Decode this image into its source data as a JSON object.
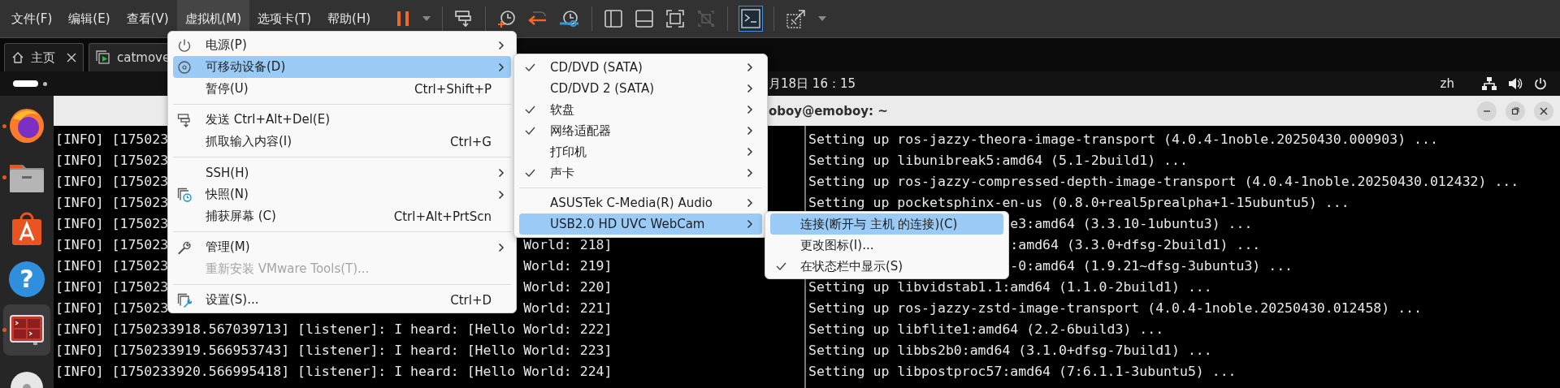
{
  "menubar": [
    {
      "label": "文件(F)",
      "selected": false
    },
    {
      "label": "编辑(E)",
      "selected": false
    },
    {
      "label": "查看(V)",
      "selected": false
    },
    {
      "label": "虚拟机(M)",
      "selected": true
    },
    {
      "label": "选项卡(T)",
      "selected": false
    },
    {
      "label": "帮助(H)",
      "selected": false
    }
  ],
  "toolbar": [
    {
      "kind": "pause",
      "selected": false
    },
    {
      "kind": "caret",
      "selected": false
    },
    {
      "kind": "separator"
    },
    {
      "kind": "send-keys",
      "selected": false
    },
    {
      "kind": "separator"
    },
    {
      "kind": "snapshot-take",
      "selected": false
    },
    {
      "kind": "snapshot-revert",
      "selected": false
    },
    {
      "kind": "snapshot-manager",
      "selected": false
    },
    {
      "kind": "separator"
    },
    {
      "kind": "sidebar",
      "selected": false
    },
    {
      "kind": "thumbnails",
      "selected": false
    },
    {
      "kind": "fullscreen",
      "selected": false
    },
    {
      "kind": "unity",
      "selected": false
    },
    {
      "kind": "separator"
    },
    {
      "kind": "console",
      "selected": true
    },
    {
      "kind": "separator"
    },
    {
      "kind": "stretch",
      "selected": false
    },
    {
      "kind": "caret",
      "selected": false
    }
  ],
  "tabs": [
    {
      "label": "主页",
      "kind": "home",
      "selected": false
    },
    {
      "label": "catmove",
      "kind": "vm",
      "selected": true
    }
  ],
  "top_bar": {
    "clock": "月18日  16：15",
    "language": "zh"
  },
  "dock": [
    {
      "kind": "firefox",
      "running": true,
      "selected": false
    },
    {
      "kind": "files",
      "running": true,
      "selected": false
    },
    {
      "kind": "app-store",
      "running": false,
      "selected": false
    },
    {
      "kind": "help",
      "glyph": "?",
      "running": false,
      "selected": false
    },
    {
      "kind": "terminal",
      "running": true,
      "selected": true
    },
    {
      "kind": "disc",
      "running": false,
      "selected": false
    }
  ],
  "terminal": {
    "title": "oboy@emoboy: ~",
    "left_pane": [
      {
        "head": "[INFO] [175023"
      },
      {
        "head": "[INFO] [175023"
      },
      {
        "head": "[INFO] [175023"
      },
      {
        "head": "[INFO] [175023"
      },
      {
        "head": "[INFO] [175023"
      },
      {
        "head": "[INFO] [175023",
        "tail": "World: 218]"
      },
      {
        "head": "[INFO] [175023",
        "tail": "World: 219]"
      },
      {
        "head": "[INFO] [175023",
        "tail": "World: 220]"
      },
      {
        "head": "[INFO] [175023",
        "tail": "World: 221]"
      },
      {
        "head": "[INFO] [1750233918.567039713] [listener]: I heard: [Hello World: 222]"
      },
      {
        "head": "[INFO] [1750233919.566953743] [listener]: I heard: [Hello World: 223]"
      },
      {
        "head": "[INFO] [1750233920.566995418] [listener]: I heard: [Hello World: 224]"
      }
    ],
    "right_pane": [
      {
        "head": "Setting up ros-jazzy-theora-image-transport (4.0.4-1noble.20250430.000903) ..."
      },
      {
        "head": "Setting up libunibreak5:amd64 (5.1-2build1) ..."
      },
      {
        "head": "Setting up ros-jazzy-compressed-depth-image-transport (4.0.4-1noble.20250430.012432) ..."
      },
      {
        "head": "Setting up pocketsphinx-en-us (0.8.0+real5prealpha+1-15ubuntu5) ..."
      },
      {
        "tail": "e3:amd64 (3.3.10-1ubuntu3) ..."
      },
      {
        "tail": ":amd64 (3.3.0+dfsg-2build1) ..."
      },
      {
        "tail": "-0:amd64 (1.9.21~dfsg-3ubuntu3) ..."
      },
      {
        "head": "Setting up libvidstab1.1:amd64 (1.1.0-2build1) ..."
      },
      {
        "head": "Setting up ros-jazzy-zstd-image-transport (4.0.4-1noble.20250430.012458) ..."
      },
      {
        "head": "Setting up libflite1:amd64 (2.2-6build3) ..."
      },
      {
        "head": "Setting up libbs2b0:amd64 (3.1.0+dfsg-7build1) ..."
      },
      {
        "head": "Setting up libpostproc57:amd64 (7:6.1.1-3ubuntu5) ..."
      }
    ]
  },
  "menus": [
    {
      "items": [
        {
          "kind": "power",
          "label": "电源(P)",
          "submenu": true,
          "selected": false,
          "disabled": false
        },
        {
          "kind": "devices",
          "label": "可移动设备(D)",
          "submenu": true,
          "selected": true,
          "disabled": false
        },
        {
          "kind": "text",
          "label": "暂停(U)",
          "shortcut": "Ctrl+Shift+P",
          "submenu": false,
          "selected": false,
          "disabled": false
        },
        {
          "kind": "separator"
        },
        {
          "kind": "send-keys",
          "label": "发送 Ctrl+Alt+Del(E)",
          "submenu": false,
          "selected": false,
          "disabled": false
        },
        {
          "kind": "text",
          "label": "抓取输入内容(I)",
          "shortcut": "Ctrl+G",
          "submenu": false,
          "selected": false,
          "disabled": false
        },
        {
          "kind": "separator"
        },
        {
          "kind": "text",
          "label": "SSH(H)",
          "submenu": true,
          "selected": false,
          "disabled": false
        },
        {
          "kind": "snapshot",
          "label": "快照(N)",
          "submenu": true,
          "selected": false,
          "disabled": false
        },
        {
          "kind": "text",
          "label": "捕获屏幕 (C)",
          "shortcut": "Ctrl+Alt+PrtScn",
          "submenu": false,
          "selected": false,
          "disabled": false
        },
        {
          "kind": "separator"
        },
        {
          "kind": "manage",
          "label": "管理(M)",
          "submenu": true,
          "selected": false,
          "disabled": false
        },
        {
          "kind": "text",
          "label": "重新安装 VMware Tools(T)...",
          "submenu": false,
          "selected": false,
          "disabled": true
        },
        {
          "kind": "separator"
        },
        {
          "kind": "settings",
          "label": "设置(S)...",
          "shortcut": "Ctrl+D",
          "submenu": false,
          "selected": false,
          "disabled": false
        }
      ]
    },
    {
      "items": [
        {
          "kind": "check",
          "label": "CD/DVD (SATA)",
          "checked": true,
          "submenu": true,
          "selected": false
        },
        {
          "kind": "check",
          "label": "CD/DVD 2 (SATA)",
          "checked": false,
          "submenu": true,
          "selected": false
        },
        {
          "kind": "check",
          "label": "软盘",
          "checked": true,
          "submenu": true,
          "selected": false
        },
        {
          "kind": "check",
          "label": "网络适配器",
          "checked": true,
          "submenu": true,
          "selected": false
        },
        {
          "kind": "check",
          "label": "打印机",
          "checked": false,
          "submenu": true,
          "selected": false
        },
        {
          "kind": "check",
          "label": "声卡",
          "checked": true,
          "submenu": true,
          "selected": false
        },
        {
          "kind": "separator"
        },
        {
          "kind": "check",
          "label": "ASUSTek C-Media(R) Audio",
          "checked": false,
          "submenu": true,
          "selected": false
        },
        {
          "kind": "check",
          "label": "USB2.0 HD UVC WebCam",
          "checked": false,
          "submenu": true,
          "selected": true
        }
      ]
    },
    {
      "items": [
        {
          "kind": "check",
          "label": "连接(断开与 主机 的连接)(C)",
          "checked": false,
          "submenu": false,
          "selected": true
        },
        {
          "kind": "check",
          "label": "更改图标(I)...",
          "checked": false,
          "submenu": false,
          "selected": false
        },
        {
          "kind": "check",
          "label": "在状态栏中显示(S)",
          "checked": true,
          "submenu": false,
          "selected": false
        }
      ]
    }
  ]
}
